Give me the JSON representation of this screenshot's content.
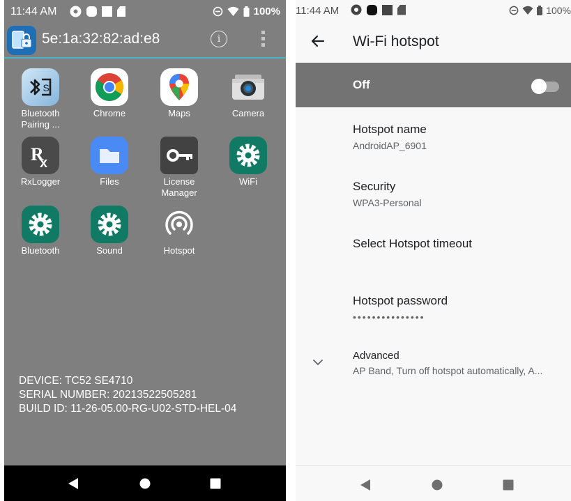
{
  "left_screen": {
    "status_bar": {
      "time": "11:44 AM",
      "battery": "100%"
    },
    "app_bar": {
      "title": "5e:1a:32:82:ad:e8",
      "info_icon": "info-icon",
      "menu_icon": "more-vert-icon"
    },
    "apps": [
      {
        "label": "Bluetooth Pairing ...",
        "icon": "bluetooth-pairing-icon"
      },
      {
        "label": "Chrome",
        "icon": "chrome-icon"
      },
      {
        "label": "Maps",
        "icon": "maps-icon"
      },
      {
        "label": "Camera",
        "icon": "camera-icon"
      },
      {
        "label": "RxLogger",
        "icon": "rxlogger-icon"
      },
      {
        "label": "Files",
        "icon": "files-icon"
      },
      {
        "label": "License Manager",
        "icon": "key-icon"
      },
      {
        "label": "WiFi",
        "icon": "settings-gear-icon"
      },
      {
        "label": "Bluetooth",
        "icon": "settings-gear-icon"
      },
      {
        "label": "Sound",
        "icon": "settings-gear-icon"
      },
      {
        "label": "Hotspot",
        "icon": "hotspot-icon"
      }
    ],
    "device_info": {
      "device": "DEVICE: TC52 SE4710",
      "serial": "SERIAL NUMBER: 20213522505281",
      "build": "BUILD ID: 11-26-05.00-RG-U02-STD-HEL-04"
    },
    "colors": {
      "background": "#7f7f7f",
      "accent_line": "#47b8c3",
      "nav_bar": "#000000"
    }
  },
  "right_screen": {
    "status_bar": {
      "time": "11:44 AM",
      "battery": "100%"
    },
    "toolbar": {
      "title": "Wi-Fi hotspot",
      "back_icon": "back-arrow-icon"
    },
    "master_switch": {
      "label": "Off",
      "state": "off"
    },
    "settings": [
      {
        "title": "Hotspot name",
        "summary": "AndroidAP_6901"
      },
      {
        "title": "Security",
        "summary": "WPA3-Personal"
      },
      {
        "title": "Select Hotspot timeout",
        "summary": ""
      },
      {
        "title": "Hotspot password",
        "summary": "•••••••••••••••"
      },
      {
        "title": "Advanced",
        "summary": "AP Band, Turn off hotspot automatically, A..."
      }
    ],
    "colors": {
      "background": "#f8f8f8",
      "switch_bar": "#737373"
    }
  }
}
